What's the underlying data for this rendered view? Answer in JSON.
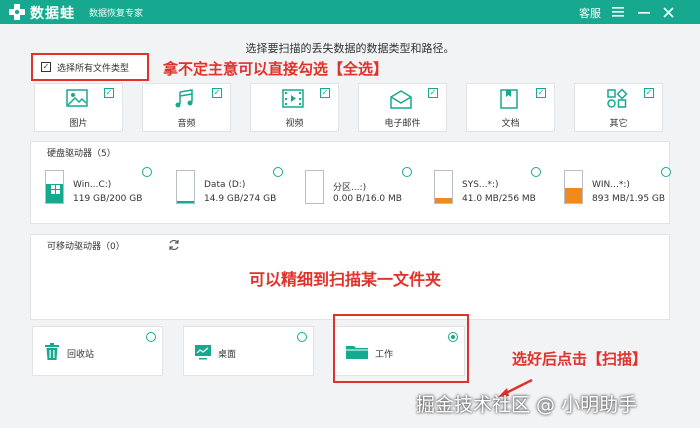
{
  "titlebar": {
    "app_name": "数据蛙",
    "tagline": "数据恢复专家",
    "support_label": "客服",
    "menu_icon": "menu-icon",
    "minimize_icon": "minimize-icon",
    "close_icon": "close-icon"
  },
  "main": {
    "prompt": "选择要扫描的丢失数据的数据类型和路径。",
    "select_all_label": "选择所有文件类型",
    "select_all_checked": true
  },
  "annotations": {
    "tip_select_all": "拿不定主意可以直接勾选【全选】",
    "tip_folder": "可以精细到扫描某一文件夹",
    "tip_scan": "选好后点击【扫描】"
  },
  "file_types": [
    {
      "label": "图片",
      "icon": "image-icon",
      "checked": true
    },
    {
      "label": "音频",
      "icon": "music-icon",
      "checked": true
    },
    {
      "label": "视频",
      "icon": "video-icon",
      "checked": true
    },
    {
      "label": "电子邮件",
      "icon": "email-icon",
      "checked": true
    },
    {
      "label": "文档",
      "icon": "document-icon",
      "checked": true
    },
    {
      "label": "其它",
      "icon": "other-icon",
      "checked": true
    }
  ],
  "hard_drives": {
    "title": "硬盘驱动器（5）",
    "items": [
      {
        "name": "Win...C:)",
        "size": "119 GB/200 GB",
        "used_fraction": 0.6,
        "color": "#17a98f"
      },
      {
        "name": "Data (D:)",
        "size": "14.9 GB/274 GB",
        "used_fraction": 0.05,
        "color": "#17a98f"
      },
      {
        "name": "分区...:)",
        "size": "0.00  B/16.0 MB",
        "used_fraction": 0.0,
        "color": "#f08a1c"
      },
      {
        "name": "SYS...*:)",
        "size": "41.0 MB/256 MB",
        "used_fraction": 0.16,
        "color": "#f08a1c"
      },
      {
        "name": "WIN...*:)",
        "size": "893 MB/1.95 GB",
        "used_fraction": 0.46,
        "color": "#f08a1c"
      }
    ]
  },
  "removable_drives": {
    "title": "可移动驱动器（0）",
    "refresh_icon": "refresh-icon"
  },
  "folders": [
    {
      "label": "回收站",
      "icon": "trash-icon",
      "selected": false
    },
    {
      "label": "桌面",
      "icon": "desktop-icon",
      "selected": false
    },
    {
      "label": "工作",
      "icon": "folder-icon",
      "selected": true
    }
  ],
  "watermark": "掘金技术社区 @ 小明助手",
  "colors": {
    "brand": "#17a98f",
    "annotation": "#e0312a",
    "partition_fill": "#f08a1c"
  }
}
